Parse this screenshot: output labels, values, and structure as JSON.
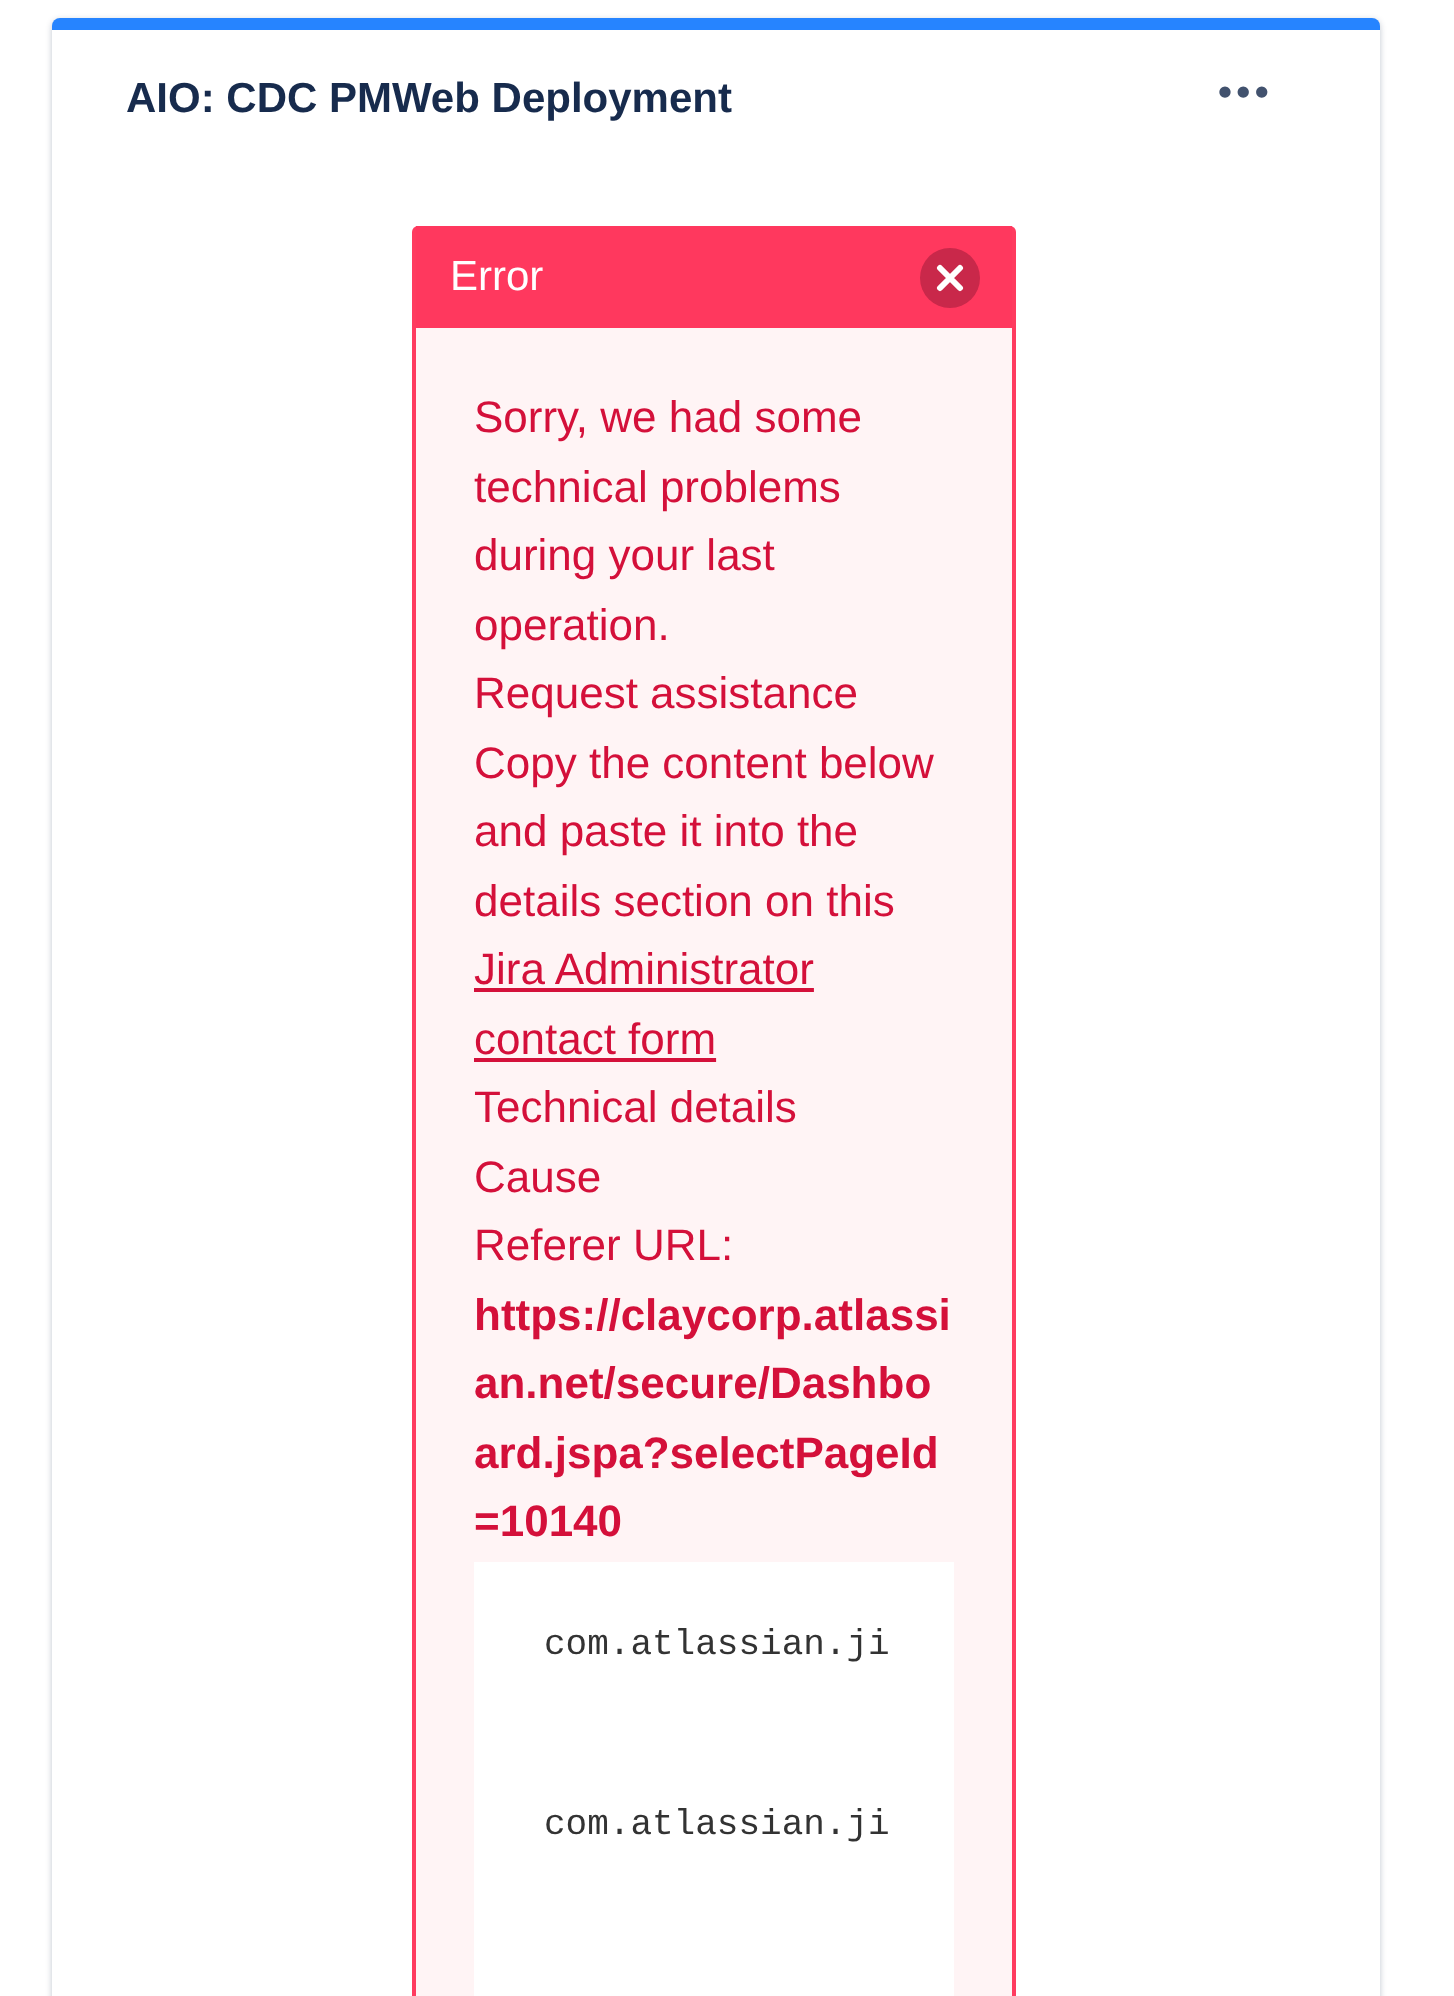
{
  "card": {
    "title": "AIO: CDC PMWeb Deployment",
    "menu_icon": "•••"
  },
  "error_dialog": {
    "title": "Error",
    "message": "Sorry, we had some technical problems during your last operation.",
    "assistance_heading": "Request assistance",
    "instructions": "Copy the content below and paste it into the details section on this",
    "contact_link": "Jira Administrator contact form",
    "details_heading": "Technical details",
    "cause_label": "Cause",
    "referer_label": "Referer URL:",
    "referer_url": "https://claycorp.atlassian.net/secure/Dashboard.jspa?selectPageId=10140",
    "stack_lines": [
      "com.atlassian.ji",
      "com.atlassian.ji"
    ]
  }
}
